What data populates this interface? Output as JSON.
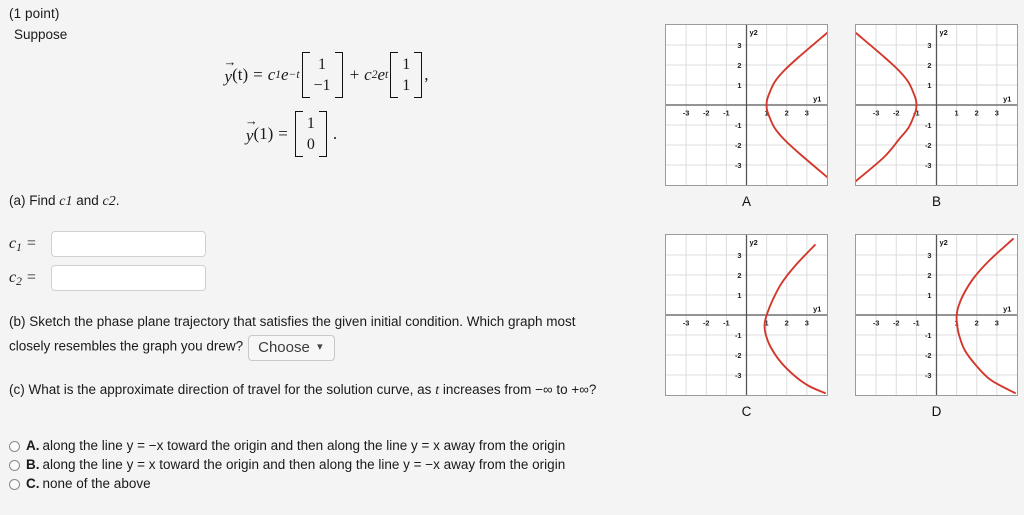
{
  "header": {
    "point_label": "(1 point)",
    "suppose_label": "Suppose"
  },
  "equations": {
    "eq1": {
      "lhs_fn": "y",
      "lhs_arg": "(t)",
      "equals": "=",
      "c1": "c",
      "c1_sub": "1",
      "exp1_base": "e",
      "exp1_pow": "−t",
      "vec1": [
        "1",
        "−1"
      ],
      "plus": "+",
      "c2": "c",
      "c2_sub": "2",
      "exp2_base": "e",
      "exp2_pow": "t",
      "vec2": [
        "1",
        "1"
      ],
      "trailing": ","
    },
    "eq2": {
      "lhs_fn": "y",
      "lhs_arg": "(1)",
      "equals": "=",
      "vec": [
        "1",
        "0"
      ],
      "trailing": "."
    }
  },
  "part_a": {
    "prompt_prefix": "(a) Find ",
    "prompt_c1": "c",
    "prompt_c1_sub": "1",
    "prompt_mid": " and ",
    "prompt_c2": "c",
    "prompt_c2_sub": "2",
    "prompt_suffix": ".",
    "fields": [
      {
        "label_base": "c",
        "label_sub": "1",
        "equals": "=",
        "value": "",
        "placeholder": ""
      },
      {
        "label_base": "c",
        "label_sub": "2",
        "equals": "=",
        "value": "",
        "placeholder": ""
      }
    ]
  },
  "part_b": {
    "text": "(b) Sketch the phase plane trajectory that satisfies the given initial condition. Which graph most closely resembles the graph you drew?",
    "select": {
      "selected": "Choose",
      "chevron": "⌄",
      "options": [
        "Choose",
        "A",
        "B",
        "C",
        "D"
      ]
    }
  },
  "part_c": {
    "text": "(c) What is the approximate direction of travel for the solution curve, as t increases from −∞ to +∞?",
    "text_pre": "(c) What is the approximate direction of travel for the solution curve, as ",
    "text_var": "t",
    "text_post": " increases from −∞ to +∞?",
    "choices": [
      {
        "letter": "A.",
        "text": "along the line y = −x toward the origin and then along the line y = x away from the origin",
        "selected": false
      },
      {
        "letter": "B.",
        "text": "along the line y = x toward the origin and then along the line y = −x away from the origin",
        "selected": false
      },
      {
        "letter": "C.",
        "text": "none of the above",
        "selected": false
      }
    ]
  },
  "graphs": {
    "axis_label_x": "y1",
    "axis_label_y": "y2",
    "curve_color": "#d2372a",
    "grid_color": "#dcdcdc",
    "axis_color": "#555555",
    "frame_color": "#9b9b9b",
    "xticks": [
      "-3",
      "-2",
      "-1",
      "1",
      "2",
      "3"
    ],
    "yticks": [
      "3",
      "2",
      "1",
      "-1",
      "-2",
      "-3"
    ],
    "xlim": [
      -4,
      4
    ],
    "ylim": [
      -4,
      4
    ],
    "items": [
      {
        "caption": "A",
        "vertex": [
          1,
          0
        ],
        "opens": "right",
        "width": 0.28
      },
      {
        "caption": "B",
        "vertex": [
          -1,
          0
        ],
        "opens": "left",
        "width": 0.28
      },
      {
        "caption": "C",
        "vertex": [
          0.9,
          -0.5
        ],
        "opens": "right",
        "width": 0.42
      },
      {
        "caption": "D",
        "vertex": [
          1,
          -0.1
        ],
        "opens": "right",
        "width": 0.2
      }
    ]
  },
  "chart_data": [
    {
      "type": "line",
      "title": "A",
      "xlabel": "y1",
      "ylabel": "y2",
      "xlim": [
        -4,
        4
      ],
      "ylim": [
        -4,
        4
      ],
      "grid": true,
      "description": "Rightward-opening curve, vertex near (1, 0), symmetric about y = 0",
      "series": [
        {
          "name": "trajectory",
          "color": "#d2372a",
          "x": [
            4.0,
            2.6,
            1.85,
            1.4,
            1.15,
            1.02,
            1.0,
            1.02,
            1.15,
            1.4,
            1.85,
            2.6,
            4.0
          ],
          "y": [
            3.6,
            2.4,
            1.7,
            1.15,
            0.62,
            0.25,
            0.0,
            -0.25,
            -0.62,
            -1.15,
            -1.7,
            -2.4,
            -3.6
          ]
        }
      ]
    },
    {
      "type": "line",
      "title": "B",
      "xlabel": "y1",
      "ylabel": "y2",
      "xlim": [
        -4,
        4
      ],
      "ylim": [
        -4,
        4
      ],
      "grid": true,
      "description": "Leftward-opening curve, vertex near (-1, 0), symmetric about y = 0",
      "series": [
        {
          "name": "trajectory",
          "color": "#d2372a",
          "x": [
            -4.0,
            -2.6,
            -1.85,
            -1.4,
            -1.15,
            -1.02,
            -1.0,
            -1.02,
            -1.15,
            -1.4,
            -1.85,
            -2.6,
            -4.0
          ],
          "y": [
            3.6,
            2.4,
            1.7,
            1.15,
            0.62,
            0.25,
            0.0,
            -0.25,
            -0.62,
            -1.15,
            -1.7,
            -2.6,
            -3.8
          ]
        }
      ]
    },
    {
      "type": "line",
      "title": "C",
      "xlabel": "y1",
      "ylabel": "y2",
      "xlim": [
        -4,
        4
      ],
      "ylim": [
        -4,
        4
      ],
      "grid": true,
      "description": "Rightward-opening curve, vertex near (0.9, -0.5), wider than A",
      "series": [
        {
          "name": "trajectory",
          "color": "#d2372a",
          "x": [
            3.4,
            2.45,
            1.75,
            1.3,
            1.02,
            0.9,
            0.95,
            1.2,
            1.7,
            2.4,
            3.1,
            3.9
          ],
          "y": [
            3.5,
            2.5,
            1.6,
            0.75,
            0.05,
            -0.45,
            -0.95,
            -1.6,
            -2.35,
            -3.05,
            -3.55,
            -3.9
          ]
        }
      ]
    },
    {
      "type": "line",
      "title": "D",
      "xlabel": "y1",
      "ylabel": "y2",
      "xlim": [
        -4,
        4
      ],
      "ylim": [
        -4,
        4
      ],
      "grid": true,
      "description": "Rightward-opening narrow curve, vertex near (1, -0.1)",
      "series": [
        {
          "name": "trajectory",
          "color": "#d2372a",
          "x": [
            3.8,
            2.6,
            1.85,
            1.35,
            1.08,
            1.0,
            1.02,
            1.12,
            1.4,
            1.95,
            2.7,
            3.9
          ],
          "y": [
            3.8,
            2.7,
            1.85,
            1.05,
            0.4,
            -0.05,
            -0.45,
            -1.0,
            -1.75,
            -2.5,
            -3.25,
            -3.9
          ]
        }
      ]
    }
  ]
}
